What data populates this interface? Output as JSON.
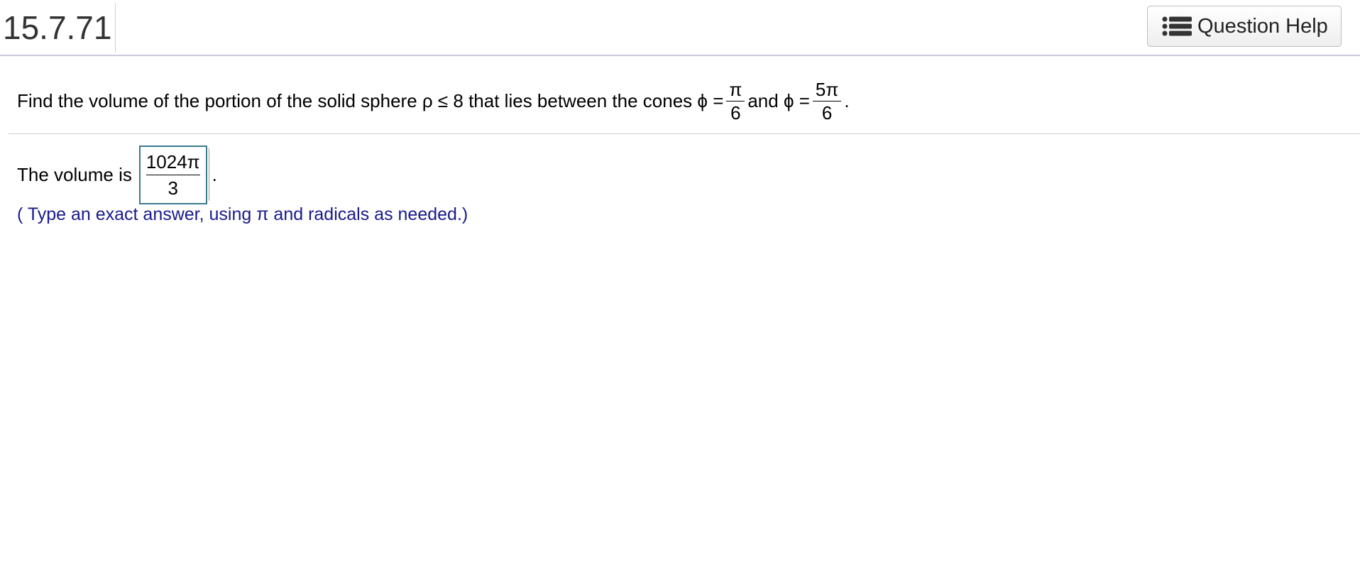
{
  "header": {
    "question_number": "15.7.71",
    "help_button_label": "Question Help",
    "help_icon": "list-icon"
  },
  "problem": {
    "text_before": "Find the volume of the portion of the solid sphere ρ ≤ 8 that lies between the cones ϕ =",
    "frac1": {
      "num": "π",
      "den": "6"
    },
    "text_and": "and ϕ =",
    "frac2": {
      "num": "5π",
      "den": "6"
    },
    "text_end": "."
  },
  "answer": {
    "label": "The volume is",
    "frac": {
      "num": "1024π",
      "den": "3"
    },
    "after": "."
  },
  "hint": "( Type an exact answer, using π and radicals as needed.)",
  "colors": {
    "hint_text": "#1a1a8c",
    "answer_box_border": "#3b7a8c"
  }
}
